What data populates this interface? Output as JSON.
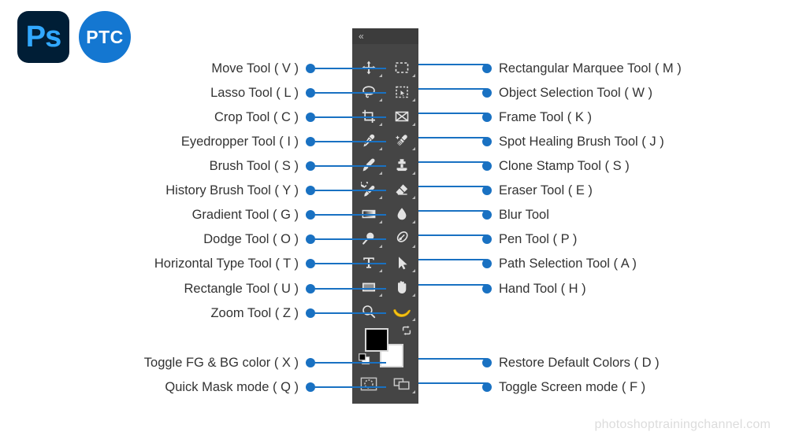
{
  "logos": {
    "photoshop": {
      "text": "Ps",
      "icon": "photoshop-logo-icon",
      "bg": "#001e36",
      "fg": "#31a8ff"
    },
    "ptc": {
      "text": "PTC",
      "icon": "ptc-logo-icon",
      "bg": "#1477d1",
      "fg": "#ffffff"
    }
  },
  "panel": {
    "collapse_glyph": "«",
    "background": "#454545",
    "header_background": "#3c3c3c"
  },
  "accent_color": "#1971c2",
  "left_labels": [
    {
      "text": "Move Tool ( V )",
      "icon": "move-tool-icon"
    },
    {
      "text": "Lasso Tool ( L )",
      "icon": "lasso-tool-icon"
    },
    {
      "text": "Crop Tool ( C )",
      "icon": "crop-tool-icon"
    },
    {
      "text": "Eyedropper Tool ( I )",
      "icon": "eyedropper-tool-icon"
    },
    {
      "text": "Brush Tool ( S )",
      "icon": "brush-tool-icon"
    },
    {
      "text": "History Brush Tool ( Y )",
      "icon": "history-brush-tool-icon"
    },
    {
      "text": "Gradient Tool ( G )",
      "icon": "gradient-tool-icon"
    },
    {
      "text": "Dodge Tool ( O )",
      "icon": "dodge-tool-icon"
    },
    {
      "text": "Horizontal Type Tool ( T )",
      "icon": "type-tool-icon"
    },
    {
      "text": "Rectangle Tool ( U )",
      "icon": "rectangle-tool-icon"
    },
    {
      "text": "Zoom Tool ( Z )",
      "icon": "zoom-tool-icon"
    }
  ],
  "left_labels_bottom": [
    {
      "text": "Toggle FG & BG color ( X )",
      "icon": "swap-colors-icon"
    },
    {
      "text": "Quick Mask mode ( Q )",
      "icon": "quick-mask-icon"
    }
  ],
  "right_labels": [
    {
      "text": "Rectangular Marquee Tool ( M )",
      "icon": "marquee-tool-icon"
    },
    {
      "text": "Object Selection Tool ( W )",
      "icon": "object-selection-tool-icon"
    },
    {
      "text": "Frame Tool ( K )",
      "icon": "frame-tool-icon"
    },
    {
      "text": "Spot Healing Brush Tool ( J )",
      "icon": "spot-healing-tool-icon"
    },
    {
      "text": "Clone Stamp Tool ( S )",
      "icon": "clone-stamp-tool-icon"
    },
    {
      "text": "Eraser Tool ( E )",
      "icon": "eraser-tool-icon"
    },
    {
      "text": "Blur Tool",
      "icon": "blur-tool-icon"
    },
    {
      "text": "Pen Tool ( P )",
      "icon": "pen-tool-icon"
    },
    {
      "text": "Path Selection Tool ( A )",
      "icon": "path-selection-tool-icon"
    },
    {
      "text": "Hand Tool ( H )",
      "icon": "hand-tool-icon"
    }
  ],
  "right_labels_bottom": [
    {
      "text": "Restore Default Colors ( D )",
      "icon": "default-colors-icon"
    },
    {
      "text": "Toggle Screen mode ( F )",
      "icon": "screen-mode-icon"
    }
  ],
  "watermark": {
    "text": "photoshoptrainingchannel.com"
  }
}
